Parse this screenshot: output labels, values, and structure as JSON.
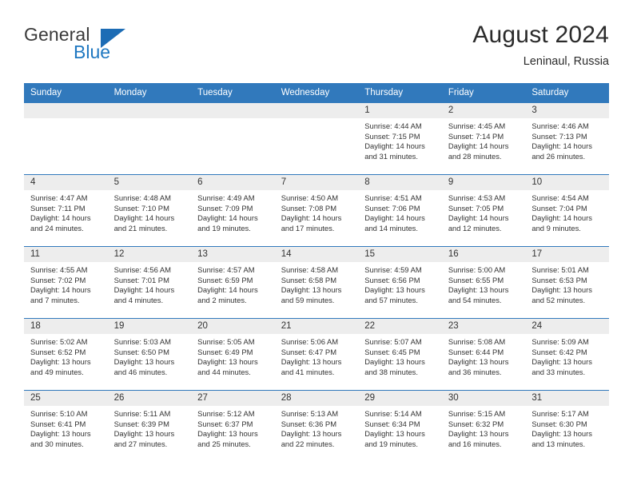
{
  "brand": {
    "name_top": "General",
    "name_bottom": "Blue",
    "triangle_color": "#1c6cb5",
    "blue_color": "#1f78c1"
  },
  "header": {
    "title": "August 2024",
    "subtitle": "Leninaul, Russia"
  },
  "colors": {
    "header_bg": "#3179bc",
    "daynum_bg": "#ededed",
    "grid_line": "#3179bc",
    "text": "#333333"
  },
  "weekday_headers": [
    "Sunday",
    "Monday",
    "Tuesday",
    "Wednesday",
    "Thursday",
    "Friday",
    "Saturday"
  ],
  "weeks": [
    [
      {
        "day": "",
        "blank": true
      },
      {
        "day": "",
        "blank": true
      },
      {
        "day": "",
        "blank": true
      },
      {
        "day": "",
        "blank": true
      },
      {
        "day": "1",
        "sunrise": "Sunrise: 4:44 AM",
        "sunset": "Sunset: 7:15 PM",
        "daylight": "Daylight: 14 hours and 31 minutes."
      },
      {
        "day": "2",
        "sunrise": "Sunrise: 4:45 AM",
        "sunset": "Sunset: 7:14 PM",
        "daylight": "Daylight: 14 hours and 28 minutes."
      },
      {
        "day": "3",
        "sunrise": "Sunrise: 4:46 AM",
        "sunset": "Sunset: 7:13 PM",
        "daylight": "Daylight: 14 hours and 26 minutes."
      }
    ],
    [
      {
        "day": "4",
        "sunrise": "Sunrise: 4:47 AM",
        "sunset": "Sunset: 7:11 PM",
        "daylight": "Daylight: 14 hours and 24 minutes."
      },
      {
        "day": "5",
        "sunrise": "Sunrise: 4:48 AM",
        "sunset": "Sunset: 7:10 PM",
        "daylight": "Daylight: 14 hours and 21 minutes."
      },
      {
        "day": "6",
        "sunrise": "Sunrise: 4:49 AM",
        "sunset": "Sunset: 7:09 PM",
        "daylight": "Daylight: 14 hours and 19 minutes."
      },
      {
        "day": "7",
        "sunrise": "Sunrise: 4:50 AM",
        "sunset": "Sunset: 7:08 PM",
        "daylight": "Daylight: 14 hours and 17 minutes."
      },
      {
        "day": "8",
        "sunrise": "Sunrise: 4:51 AM",
        "sunset": "Sunset: 7:06 PM",
        "daylight": "Daylight: 14 hours and 14 minutes."
      },
      {
        "day": "9",
        "sunrise": "Sunrise: 4:53 AM",
        "sunset": "Sunset: 7:05 PM",
        "daylight": "Daylight: 14 hours and 12 minutes."
      },
      {
        "day": "10",
        "sunrise": "Sunrise: 4:54 AM",
        "sunset": "Sunset: 7:04 PM",
        "daylight": "Daylight: 14 hours and 9 minutes."
      }
    ],
    [
      {
        "day": "11",
        "sunrise": "Sunrise: 4:55 AM",
        "sunset": "Sunset: 7:02 PM",
        "daylight": "Daylight: 14 hours and 7 minutes."
      },
      {
        "day": "12",
        "sunrise": "Sunrise: 4:56 AM",
        "sunset": "Sunset: 7:01 PM",
        "daylight": "Daylight: 14 hours and 4 minutes."
      },
      {
        "day": "13",
        "sunrise": "Sunrise: 4:57 AM",
        "sunset": "Sunset: 6:59 PM",
        "daylight": "Daylight: 14 hours and 2 minutes."
      },
      {
        "day": "14",
        "sunrise": "Sunrise: 4:58 AM",
        "sunset": "Sunset: 6:58 PM",
        "daylight": "Daylight: 13 hours and 59 minutes."
      },
      {
        "day": "15",
        "sunrise": "Sunrise: 4:59 AM",
        "sunset": "Sunset: 6:56 PM",
        "daylight": "Daylight: 13 hours and 57 minutes."
      },
      {
        "day": "16",
        "sunrise": "Sunrise: 5:00 AM",
        "sunset": "Sunset: 6:55 PM",
        "daylight": "Daylight: 13 hours and 54 minutes."
      },
      {
        "day": "17",
        "sunrise": "Sunrise: 5:01 AM",
        "sunset": "Sunset: 6:53 PM",
        "daylight": "Daylight: 13 hours and 52 minutes."
      }
    ],
    [
      {
        "day": "18",
        "sunrise": "Sunrise: 5:02 AM",
        "sunset": "Sunset: 6:52 PM",
        "daylight": "Daylight: 13 hours and 49 minutes."
      },
      {
        "day": "19",
        "sunrise": "Sunrise: 5:03 AM",
        "sunset": "Sunset: 6:50 PM",
        "daylight": "Daylight: 13 hours and 46 minutes."
      },
      {
        "day": "20",
        "sunrise": "Sunrise: 5:05 AM",
        "sunset": "Sunset: 6:49 PM",
        "daylight": "Daylight: 13 hours and 44 minutes."
      },
      {
        "day": "21",
        "sunrise": "Sunrise: 5:06 AM",
        "sunset": "Sunset: 6:47 PM",
        "daylight": "Daylight: 13 hours and 41 minutes."
      },
      {
        "day": "22",
        "sunrise": "Sunrise: 5:07 AM",
        "sunset": "Sunset: 6:45 PM",
        "daylight": "Daylight: 13 hours and 38 minutes."
      },
      {
        "day": "23",
        "sunrise": "Sunrise: 5:08 AM",
        "sunset": "Sunset: 6:44 PM",
        "daylight": "Daylight: 13 hours and 36 minutes."
      },
      {
        "day": "24",
        "sunrise": "Sunrise: 5:09 AM",
        "sunset": "Sunset: 6:42 PM",
        "daylight": "Daylight: 13 hours and 33 minutes."
      }
    ],
    [
      {
        "day": "25",
        "sunrise": "Sunrise: 5:10 AM",
        "sunset": "Sunset: 6:41 PM",
        "daylight": "Daylight: 13 hours and 30 minutes."
      },
      {
        "day": "26",
        "sunrise": "Sunrise: 5:11 AM",
        "sunset": "Sunset: 6:39 PM",
        "daylight": "Daylight: 13 hours and 27 minutes."
      },
      {
        "day": "27",
        "sunrise": "Sunrise: 5:12 AM",
        "sunset": "Sunset: 6:37 PM",
        "daylight": "Daylight: 13 hours and 25 minutes."
      },
      {
        "day": "28",
        "sunrise": "Sunrise: 5:13 AM",
        "sunset": "Sunset: 6:36 PM",
        "daylight": "Daylight: 13 hours and 22 minutes."
      },
      {
        "day": "29",
        "sunrise": "Sunrise: 5:14 AM",
        "sunset": "Sunset: 6:34 PM",
        "daylight": "Daylight: 13 hours and 19 minutes."
      },
      {
        "day": "30",
        "sunrise": "Sunrise: 5:15 AM",
        "sunset": "Sunset: 6:32 PM",
        "daylight": "Daylight: 13 hours and 16 minutes."
      },
      {
        "day": "31",
        "sunrise": "Sunrise: 5:17 AM",
        "sunset": "Sunset: 6:30 PM",
        "daylight": "Daylight: 13 hours and 13 minutes."
      }
    ]
  ]
}
